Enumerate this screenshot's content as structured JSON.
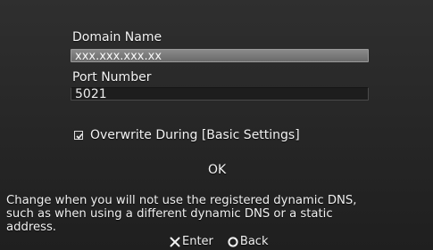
{
  "form": {
    "domain_name": {
      "label": "Domain Name",
      "value": "xxx.xxx.xxx.xx"
    },
    "port_number": {
      "label": "Port Number",
      "value": "5021"
    },
    "overwrite_checkbox": {
      "label": "Overwrite During [Basic Settings]",
      "checked": true
    },
    "ok_label": "OK"
  },
  "help_text": {
    "line1": "Change when you will not use the registered dynamic DNS,",
    "line2": "such as when using a different dynamic DNS or a static",
    "line3": "address."
  },
  "controls": {
    "enter": {
      "icon": "cross-button-icon",
      "label": "Enter"
    },
    "back": {
      "icon": "circle-button-icon",
      "label": "Back"
    }
  },
  "colors": {
    "background": "#2a2a2a",
    "selected_field": "#7a7a7a",
    "text": "#f2f2f2"
  }
}
